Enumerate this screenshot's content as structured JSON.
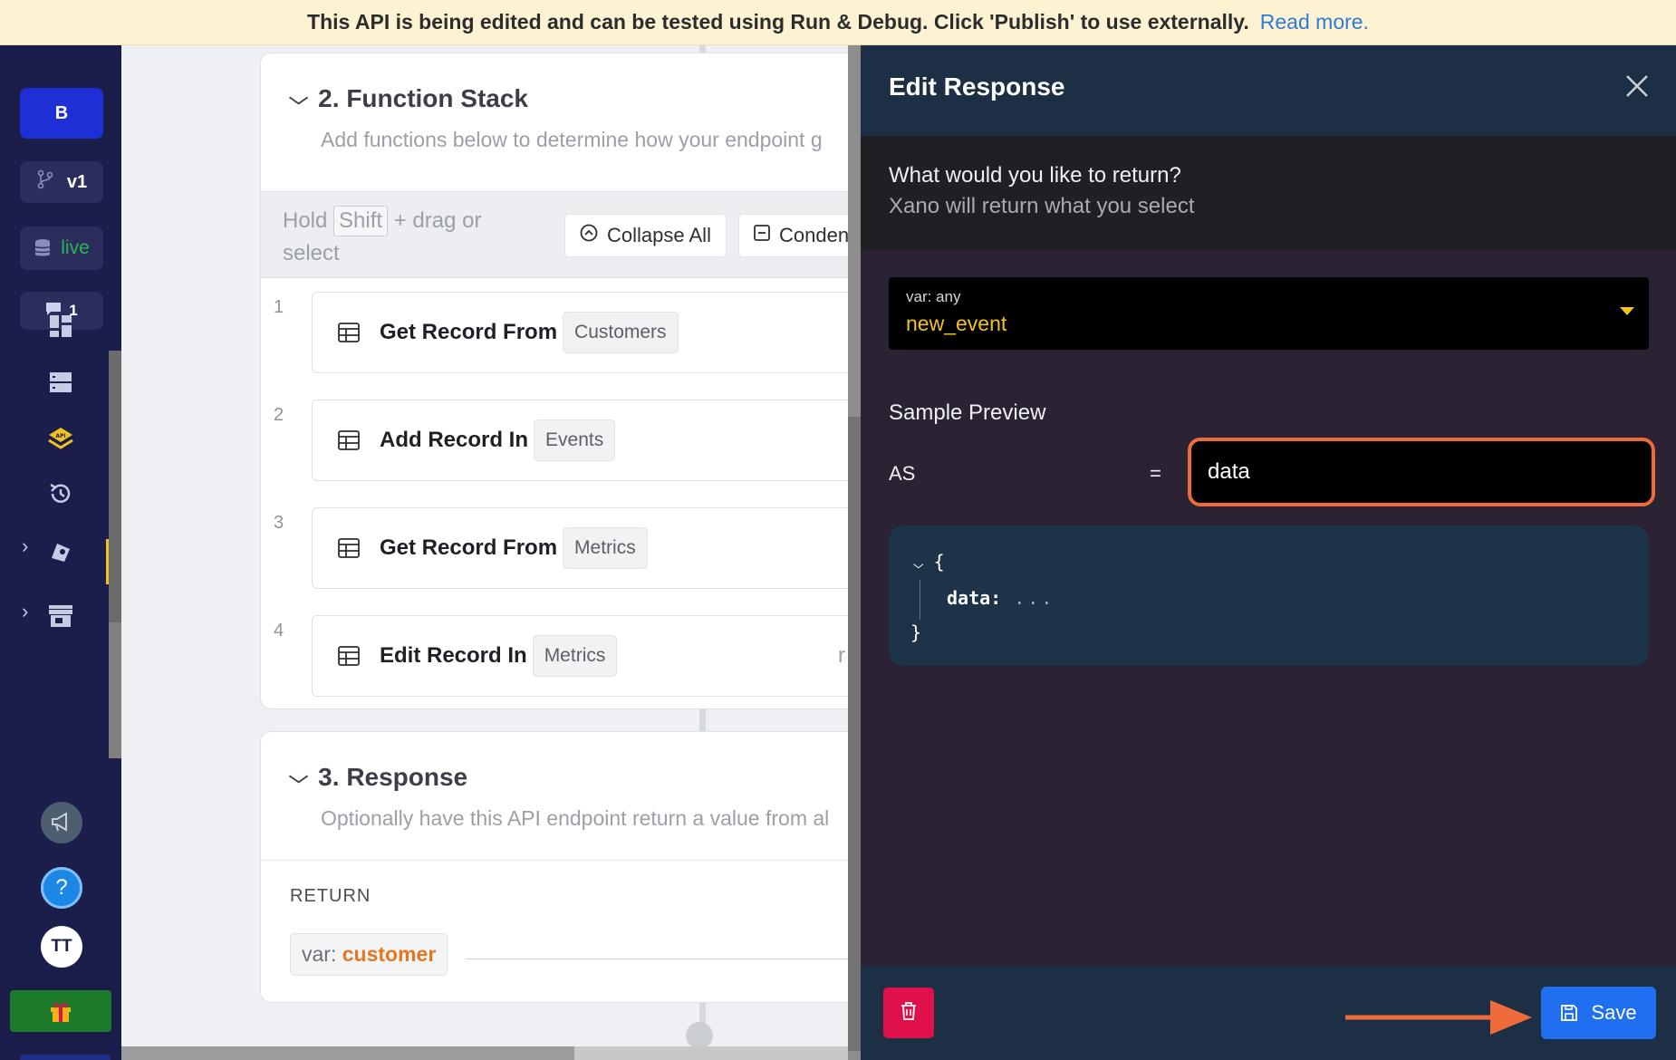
{
  "banner": {
    "message": "This API is being edited and can be tested using Run & Debug. Click 'Publish' to use externally.",
    "link": "Read more."
  },
  "sidebar": {
    "workspace_initial": "B",
    "branch": "v1",
    "datasource": "live",
    "comments_count": "1",
    "user_initials": "TT",
    "icons": [
      "branch-icon",
      "database-icon",
      "comment-icon",
      "dashboard-icon",
      "database-tables-icon",
      "api-icon",
      "history-icon",
      "addons-icon",
      "marketplace-icon",
      "announcement-icon",
      "help-icon",
      "gift-icon",
      "expand-icon"
    ]
  },
  "function_stack": {
    "number": "2.",
    "title": "Function Stack",
    "description": "Add functions below to determine how your endpoint g",
    "hold_text_1": "Hold",
    "hold_key": "Shift",
    "hold_text_2": "+ drag or select",
    "collapse_all": "Collapse All",
    "condense": "Conden",
    "items": [
      {
        "num": "1",
        "name": "Get Record From",
        "table": "Customers",
        "trail": ""
      },
      {
        "num": "2",
        "name": "Add Record In",
        "table": "Events",
        "trail": ""
      },
      {
        "num": "3",
        "name": "Get Record From",
        "table": "Metrics",
        "trail": ""
      },
      {
        "num": "4",
        "name": "Edit Record In",
        "table": "Metrics",
        "trail": "r"
      }
    ]
  },
  "response": {
    "number": "3.",
    "title": "Response",
    "description": "Optionally have this API endpoint return a value from al",
    "return_label": "RETURN",
    "var_prefix": "var:",
    "var_name": "customer"
  },
  "edit_panel": {
    "title": "Edit Response",
    "question": "What would you like to return?",
    "subtitle": "Xano will return what you select",
    "select_type": "var: any",
    "select_value": "new_event",
    "sample_preview": "Sample Preview",
    "as_label": "AS",
    "equals": "=",
    "as_value": "data",
    "code_open": "{",
    "code_key": "data:",
    "code_value": "...",
    "code_close": "}",
    "save_label": "Save"
  },
  "colors": {
    "banner_bg": "#fdf3d3",
    "sidebar_bg": "#1b1d4b",
    "accent_yellow": "#f2c31c",
    "var_orange": "#e67722",
    "highlight_orange": "#f06b3a",
    "save_blue": "#1f6ff0",
    "delete_red": "#e0114a",
    "live_green": "#29b554"
  }
}
